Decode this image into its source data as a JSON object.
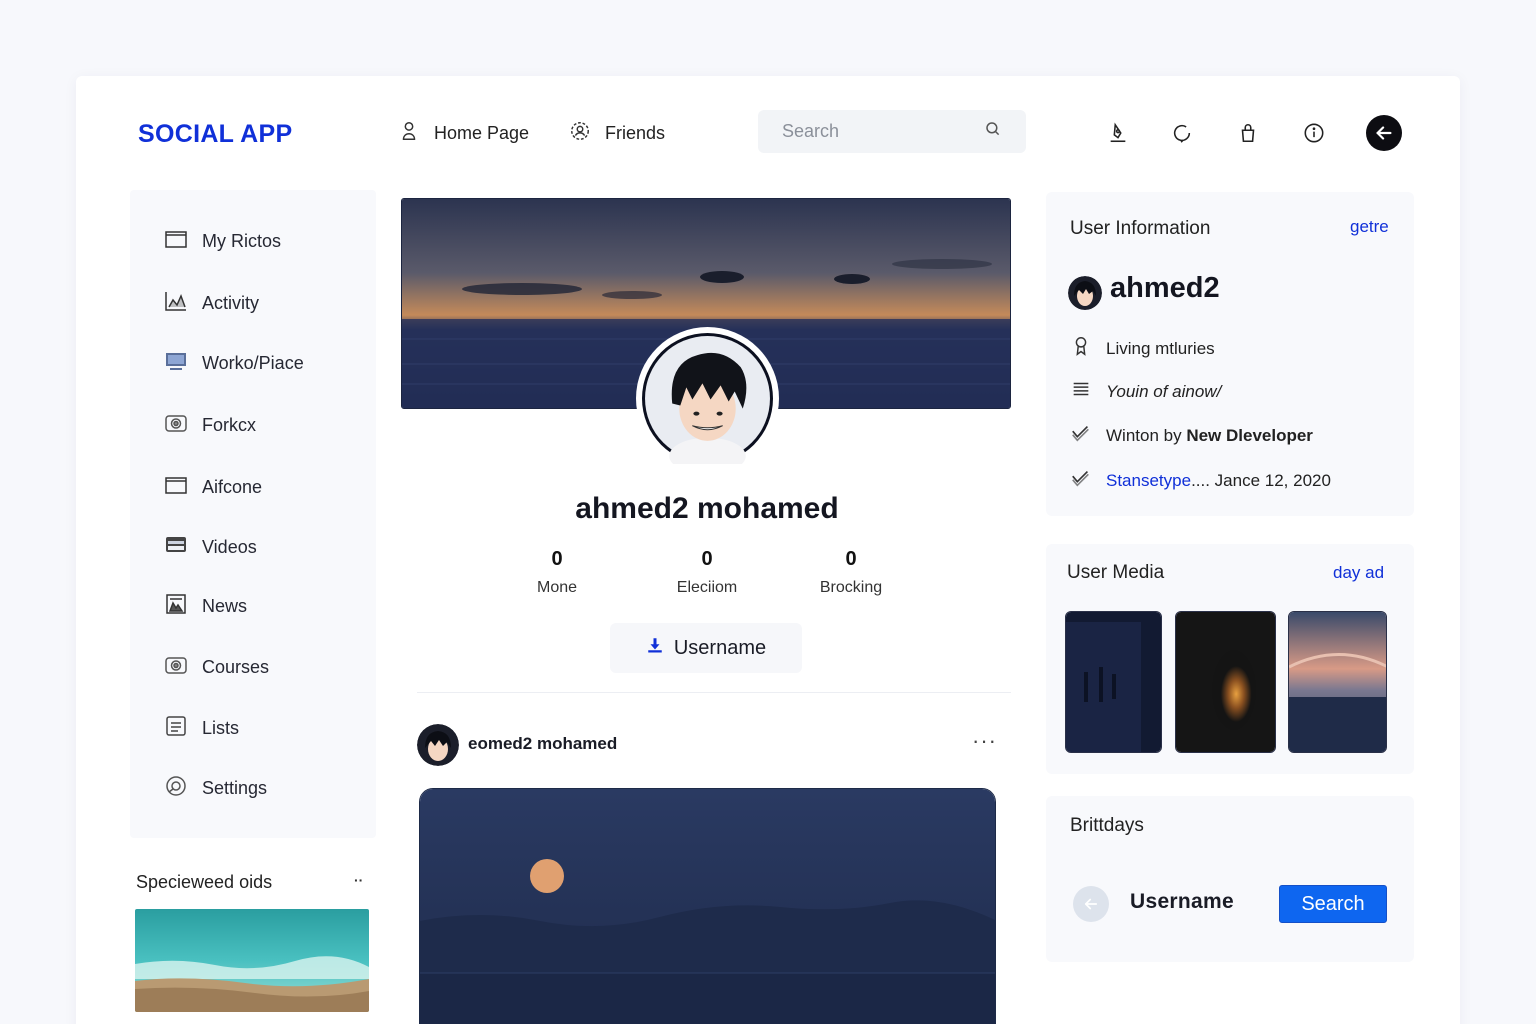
{
  "app": {
    "title": "SOCIAL APP"
  },
  "nav": {
    "home_label": "Home Page",
    "friends_label": "Friends",
    "search_placeholder": "Search"
  },
  "header_icons": [
    "pen-user-icon",
    "chat-bubble-icon",
    "bag-icon",
    "info-icon",
    "back-arrow-icon"
  ],
  "sidebar": {
    "items": [
      {
        "label": "My Rictos",
        "icon": "folder-icon"
      },
      {
        "label": "Activity",
        "icon": "chart-icon"
      },
      {
        "label": "Worko/Piace",
        "icon": "monitor-icon"
      },
      {
        "label": "Forkcx",
        "icon": "camera-icon"
      },
      {
        "label": "Aifcone",
        "icon": "folder-icon"
      },
      {
        "label": "Videos",
        "icon": "video-icon"
      },
      {
        "label": "News",
        "icon": "news-icon"
      },
      {
        "label": "Courses",
        "icon": "camera-icon"
      },
      {
        "label": "Lists",
        "icon": "list-icon"
      },
      {
        "label": "Settings",
        "icon": "settings-icon"
      }
    ]
  },
  "suggested": {
    "title": "Specieweed oids",
    "more": "··"
  },
  "profile": {
    "name": "ahmed2 mohamed",
    "stats": [
      {
        "value": "0",
        "label": "Mone"
      },
      {
        "value": "0",
        "label": "Eleciiom"
      },
      {
        "value": "0",
        "label": "Brocking"
      }
    ],
    "button_label": "Username"
  },
  "post": {
    "author": "eomed2 mohamed",
    "more": "···"
  },
  "user_info": {
    "title": "User Information",
    "link": "getre",
    "name": "ahmed2",
    "rows": [
      {
        "text": "Living mtluries"
      },
      {
        "text": "Youin of ainow/"
      },
      {
        "text_prefix": "Winton by ",
        "text_bold": "New Dleveloper"
      },
      {
        "text_link": "Stansetype",
        "text_rest": ".... Jance 12, 2020"
      }
    ]
  },
  "user_media": {
    "title": "User Media",
    "link": "day ad"
  },
  "birthdays": {
    "title": "Brittdays",
    "username": "Username",
    "button_label": "Search"
  },
  "colors": {
    "accent": "#1030d8",
    "button_blue": "#0e66f0"
  }
}
